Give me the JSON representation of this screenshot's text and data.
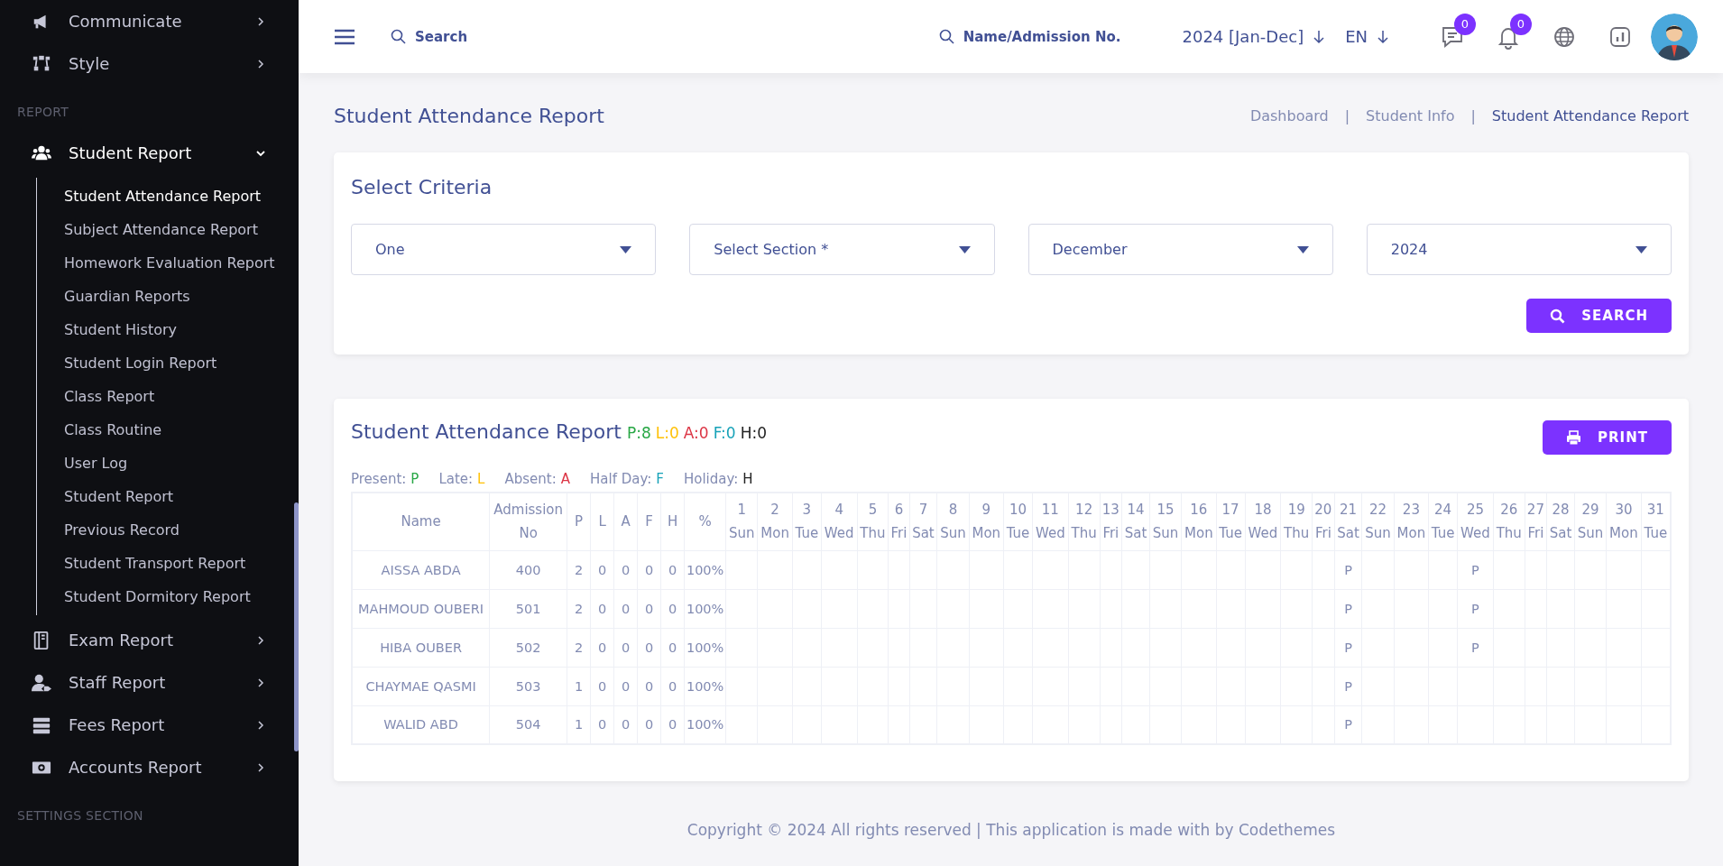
{
  "sidebar": {
    "items": [
      {
        "label": "Communicate",
        "kind": "menu",
        "expanded": false
      },
      {
        "label": "Style",
        "kind": "menu",
        "expanded": false
      },
      {
        "label": "REPORT",
        "kind": "section"
      },
      {
        "label": "Student Report",
        "kind": "menu",
        "expanded": true,
        "children": [
          {
            "label": "Student Attendance Report",
            "selected": true
          },
          {
            "label": "Subject Attendance Report",
            "selected": false
          },
          {
            "label": "Homework Evaluation Report",
            "selected": false
          },
          {
            "label": "Guardian Reports",
            "selected": false
          },
          {
            "label": "Student History",
            "selected": false
          },
          {
            "label": "Student Login Report",
            "selected": false
          },
          {
            "label": "Class Report",
            "selected": false
          },
          {
            "label": "Class Routine",
            "selected": false
          },
          {
            "label": "User Log",
            "selected": false
          },
          {
            "label": "Student Report",
            "selected": false
          },
          {
            "label": "Previous Record",
            "selected": false
          },
          {
            "label": "Student Transport Report",
            "selected": false
          },
          {
            "label": "Student Dormitory Report",
            "selected": false
          }
        ]
      },
      {
        "label": "Exam Report",
        "kind": "menu",
        "expanded": false
      },
      {
        "label": "Staff Report",
        "kind": "menu",
        "expanded": false
      },
      {
        "label": "Fees Report",
        "kind": "menu",
        "expanded": false
      },
      {
        "label": "Accounts Report",
        "kind": "menu",
        "expanded": false
      },
      {
        "label": "SETTINGS SECTION",
        "kind": "section"
      }
    ]
  },
  "header": {
    "search": {
      "placeholder": "Search"
    },
    "student_search": {
      "placeholder": "Name/Admission No."
    },
    "session": "2024 [Jan-Dec]",
    "language": "EN",
    "messages_count": "0",
    "notifications_count": "0"
  },
  "page": {
    "title": "Student Attendance Report",
    "breadcrumb_separator": "|",
    "breadcrumbs": [
      {
        "label": "Dashboard",
        "selected": false
      },
      {
        "label": "Student Info",
        "selected": false
      },
      {
        "label": "Student Attendance Report",
        "selected": true
      }
    ]
  },
  "criteria": {
    "title": "Select Criteria",
    "fields": [
      {
        "value": "One"
      },
      {
        "placeholder": "Select Section *"
      },
      {
        "value": "December"
      },
      {
        "value": "2024"
      }
    ],
    "button": "SEARCH"
  },
  "report": {
    "title": "Student Attendance Report",
    "summary": [
      {
        "label": "P:8",
        "color": "#28a745"
      },
      {
        "label": "L:0",
        "color": "#ffc107"
      },
      {
        "label": "A:0",
        "color": "#dc3545"
      },
      {
        "label": "F:0",
        "color": "#17a2b8"
      },
      {
        "label": "H:0",
        "color": "#222222"
      }
    ],
    "legend": [
      {
        "label": "Present:",
        "code": "P",
        "color": "#28a745"
      },
      {
        "label": "Late:",
        "code": "L",
        "color": "#ffc107"
      },
      {
        "label": "Absent:",
        "code": "A",
        "color": "#dc3545"
      },
      {
        "label": "Half Day:",
        "code": "F",
        "color": "#17a2b8"
      },
      {
        "label": "Holiday:",
        "code": "H",
        "color": "#222222"
      }
    ],
    "print_button": "PRINT",
    "table": {
      "columns": [
        "Name",
        "Admission No",
        "P",
        "L",
        "A",
        "F",
        "H",
        "%"
      ],
      "days": [
        {
          "day": "1",
          "weekday": "Sun"
        },
        {
          "day": "2",
          "weekday": "Mon"
        },
        {
          "day": "3",
          "weekday": "Tue"
        },
        {
          "day": "4",
          "weekday": "Wed"
        },
        {
          "day": "5",
          "weekday": "Thu"
        },
        {
          "day": "6",
          "weekday": "Fri"
        },
        {
          "day": "7",
          "weekday": "Sat"
        },
        {
          "day": "8",
          "weekday": "Sun"
        },
        {
          "day": "9",
          "weekday": "Mon"
        },
        {
          "day": "10",
          "weekday": "Tue"
        },
        {
          "day": "11",
          "weekday": "Wed"
        },
        {
          "day": "12",
          "weekday": "Thu"
        },
        {
          "day": "13",
          "weekday": "Fri"
        },
        {
          "day": "14",
          "weekday": "Sat"
        },
        {
          "day": "15",
          "weekday": "Sun"
        },
        {
          "day": "16",
          "weekday": "Mon"
        },
        {
          "day": "17",
          "weekday": "Tue"
        },
        {
          "day": "18",
          "weekday": "Wed"
        },
        {
          "day": "19",
          "weekday": "Thu"
        },
        {
          "day": "20",
          "weekday": "Fri"
        },
        {
          "day": "21",
          "weekday": "Sat",
          "marks": [
            "P",
            "P",
            "P",
            "P",
            "P"
          ]
        },
        {
          "day": "22",
          "weekday": "Sun"
        },
        {
          "day": "23",
          "weekday": "Mon"
        },
        {
          "day": "24",
          "weekday": "Tue"
        },
        {
          "day": "25",
          "weekday": "Wed",
          "marks": [
            "P",
            "P",
            "P"
          ]
        },
        {
          "day": "26",
          "weekday": "Thu"
        },
        {
          "day": "27",
          "weekday": "Fri"
        },
        {
          "day": "28",
          "weekday": "Sat"
        },
        {
          "day": "29",
          "weekday": "Sun"
        },
        {
          "day": "30",
          "weekday": "Mon"
        },
        {
          "day": "31",
          "weekday": "Tue"
        }
      ],
      "rows": [
        {
          "cells": [
            "AISSA ABDA",
            "400",
            "2",
            "0",
            "0",
            "0",
            "0",
            "100%"
          ]
        },
        {
          "cells": [
            "MAHMOUD OUBERI",
            "501",
            "2",
            "0",
            "0",
            "0",
            "0",
            "100%"
          ]
        },
        {
          "cells": [
            "HIBA OUBER",
            "502",
            "2",
            "0",
            "0",
            "0",
            "0",
            "100%"
          ]
        },
        {
          "cells": [
            "CHAYMAE QASMI",
            "503",
            "1",
            "0",
            "0",
            "0",
            "0",
            "100%"
          ]
        },
        {
          "cells": [
            "WALID ABD",
            "504",
            "1",
            "0",
            "0",
            "0",
            "0",
            "100%"
          ]
        }
      ]
    }
  },
  "footer": "Copyright © 2024 All rights reserved | This application is made with by Codethemes"
}
